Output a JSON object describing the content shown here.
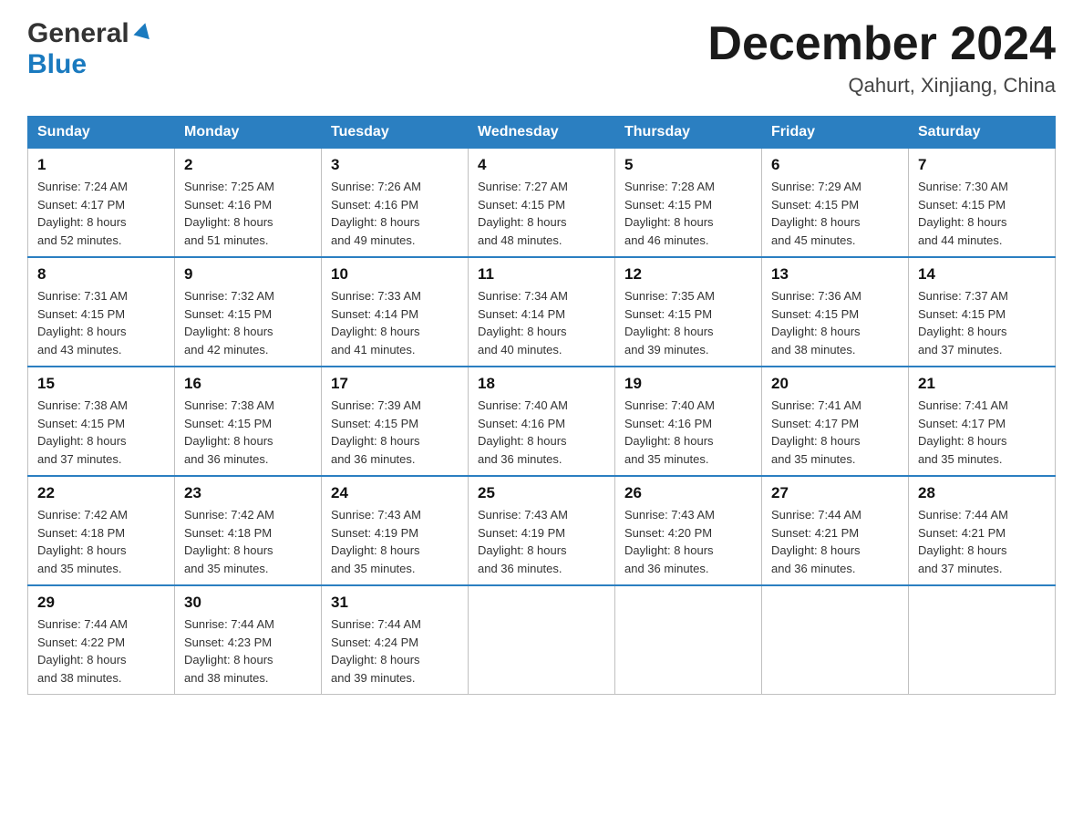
{
  "header": {
    "logo_general": "General",
    "logo_blue": "Blue",
    "month_title": "December 2024",
    "location": "Qahurt, Xinjiang, China"
  },
  "days_of_week": [
    "Sunday",
    "Monday",
    "Tuesday",
    "Wednesday",
    "Thursday",
    "Friday",
    "Saturday"
  ],
  "weeks": [
    [
      {
        "day": "1",
        "sunrise": "7:24 AM",
        "sunset": "4:17 PM",
        "daylight": "8 hours and 52 minutes."
      },
      {
        "day": "2",
        "sunrise": "7:25 AM",
        "sunset": "4:16 PM",
        "daylight": "8 hours and 51 minutes."
      },
      {
        "day": "3",
        "sunrise": "7:26 AM",
        "sunset": "4:16 PM",
        "daylight": "8 hours and 49 minutes."
      },
      {
        "day": "4",
        "sunrise": "7:27 AM",
        "sunset": "4:15 PM",
        "daylight": "8 hours and 48 minutes."
      },
      {
        "day": "5",
        "sunrise": "7:28 AM",
        "sunset": "4:15 PM",
        "daylight": "8 hours and 46 minutes."
      },
      {
        "day": "6",
        "sunrise": "7:29 AM",
        "sunset": "4:15 PM",
        "daylight": "8 hours and 45 minutes."
      },
      {
        "day": "7",
        "sunrise": "7:30 AM",
        "sunset": "4:15 PM",
        "daylight": "8 hours and 44 minutes."
      }
    ],
    [
      {
        "day": "8",
        "sunrise": "7:31 AM",
        "sunset": "4:15 PM",
        "daylight": "8 hours and 43 minutes."
      },
      {
        "day": "9",
        "sunrise": "7:32 AM",
        "sunset": "4:15 PM",
        "daylight": "8 hours and 42 minutes."
      },
      {
        "day": "10",
        "sunrise": "7:33 AM",
        "sunset": "4:14 PM",
        "daylight": "8 hours and 41 minutes."
      },
      {
        "day": "11",
        "sunrise": "7:34 AM",
        "sunset": "4:14 PM",
        "daylight": "8 hours and 40 minutes."
      },
      {
        "day": "12",
        "sunrise": "7:35 AM",
        "sunset": "4:15 PM",
        "daylight": "8 hours and 39 minutes."
      },
      {
        "day": "13",
        "sunrise": "7:36 AM",
        "sunset": "4:15 PM",
        "daylight": "8 hours and 38 minutes."
      },
      {
        "day": "14",
        "sunrise": "7:37 AM",
        "sunset": "4:15 PM",
        "daylight": "8 hours and 37 minutes."
      }
    ],
    [
      {
        "day": "15",
        "sunrise": "7:38 AM",
        "sunset": "4:15 PM",
        "daylight": "8 hours and 37 minutes."
      },
      {
        "day": "16",
        "sunrise": "7:38 AM",
        "sunset": "4:15 PM",
        "daylight": "8 hours and 36 minutes."
      },
      {
        "day": "17",
        "sunrise": "7:39 AM",
        "sunset": "4:15 PM",
        "daylight": "8 hours and 36 minutes."
      },
      {
        "day": "18",
        "sunrise": "7:40 AM",
        "sunset": "4:16 PM",
        "daylight": "8 hours and 36 minutes."
      },
      {
        "day": "19",
        "sunrise": "7:40 AM",
        "sunset": "4:16 PM",
        "daylight": "8 hours and 35 minutes."
      },
      {
        "day": "20",
        "sunrise": "7:41 AM",
        "sunset": "4:17 PM",
        "daylight": "8 hours and 35 minutes."
      },
      {
        "day": "21",
        "sunrise": "7:41 AM",
        "sunset": "4:17 PM",
        "daylight": "8 hours and 35 minutes."
      }
    ],
    [
      {
        "day": "22",
        "sunrise": "7:42 AM",
        "sunset": "4:18 PM",
        "daylight": "8 hours and 35 minutes."
      },
      {
        "day": "23",
        "sunrise": "7:42 AM",
        "sunset": "4:18 PM",
        "daylight": "8 hours and 35 minutes."
      },
      {
        "day": "24",
        "sunrise": "7:43 AM",
        "sunset": "4:19 PM",
        "daylight": "8 hours and 35 minutes."
      },
      {
        "day": "25",
        "sunrise": "7:43 AM",
        "sunset": "4:19 PM",
        "daylight": "8 hours and 36 minutes."
      },
      {
        "day": "26",
        "sunrise": "7:43 AM",
        "sunset": "4:20 PM",
        "daylight": "8 hours and 36 minutes."
      },
      {
        "day": "27",
        "sunrise": "7:44 AM",
        "sunset": "4:21 PM",
        "daylight": "8 hours and 36 minutes."
      },
      {
        "day": "28",
        "sunrise": "7:44 AM",
        "sunset": "4:21 PM",
        "daylight": "8 hours and 37 minutes."
      }
    ],
    [
      {
        "day": "29",
        "sunrise": "7:44 AM",
        "sunset": "4:22 PM",
        "daylight": "8 hours and 38 minutes."
      },
      {
        "day": "30",
        "sunrise": "7:44 AM",
        "sunset": "4:23 PM",
        "daylight": "8 hours and 38 minutes."
      },
      {
        "day": "31",
        "sunrise": "7:44 AM",
        "sunset": "4:24 PM",
        "daylight": "8 hours and 39 minutes."
      },
      null,
      null,
      null,
      null
    ]
  ],
  "labels": {
    "sunrise": "Sunrise: ",
    "sunset": "Sunset: ",
    "daylight": "Daylight: "
  }
}
